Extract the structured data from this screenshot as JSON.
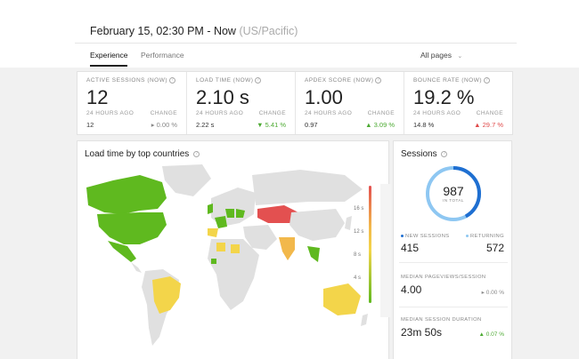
{
  "header": {
    "time_range": "February 15, 02:30 PM - Now",
    "timezone": "(US/Pacific)",
    "tabs": [
      {
        "label": "Experience",
        "active": true
      },
      {
        "label": "Performance",
        "active": false
      }
    ],
    "pages_filter": "All pages"
  },
  "metrics": [
    {
      "label": "ACTIVE SESSIONS (NOW)",
      "value": "12",
      "prev_label": "24 HOURS AGO",
      "prev_value": "12",
      "change_label": "CHANGE",
      "change": "0.00 %",
      "change_icon": "▸",
      "trend": "neutral"
    },
    {
      "label": "LOAD TIME (NOW)",
      "value": "2.10 s",
      "prev_label": "24 HOURS AGO",
      "prev_value": "2.22 s",
      "change_label": "CHANGE",
      "change": "5.41 %",
      "change_icon": "▼",
      "trend": "good"
    },
    {
      "label": "APDEX SCORE (NOW)",
      "value": "1.00",
      "prev_label": "24 HOURS AGO",
      "prev_value": "0.97",
      "change_label": "CHANGE",
      "change": "3.09 %",
      "change_icon": "▲",
      "trend": "good"
    },
    {
      "label": "BOUNCE RATE (NOW)",
      "value": "19.2 %",
      "prev_label": "24 HOURS AGO",
      "prev_value": "14.8 %",
      "change_label": "CHANGE",
      "change": "29.7 %",
      "change_icon": "▲",
      "trend": "bad"
    }
  ],
  "map": {
    "title": "Load time by top countries",
    "legend_ticks": [
      "16 s",
      "12 s",
      "8 s",
      "4 s"
    ],
    "colors": {
      "fast": "#5fb91f",
      "medium": "#f3d54a",
      "slow": "#f2b84b",
      "very_slow": "#e35050",
      "no_data": "#e0e0e0"
    }
  },
  "sessions": {
    "title": "Sessions",
    "total": "987",
    "total_label": "IN TOTAL",
    "new_fraction": 0.42,
    "new_label": "NEW SESSIONS",
    "new_value": "415",
    "returning_label": "RETURNING",
    "returning_value": "572",
    "pageviews_label": "MEDIAN PAGEVIEWS/SESSION",
    "pageviews_value": "4.00",
    "pageviews_change": "0.00 %",
    "pageviews_change_icon": "▸",
    "duration_label": "MEDIAN SESSION DURATION",
    "duration_value": "23m 50s",
    "duration_change": "0.07 %",
    "duration_change_icon": "▲",
    "colors": {
      "new": "#1f6fd1",
      "returning": "#8ec7f2"
    }
  }
}
